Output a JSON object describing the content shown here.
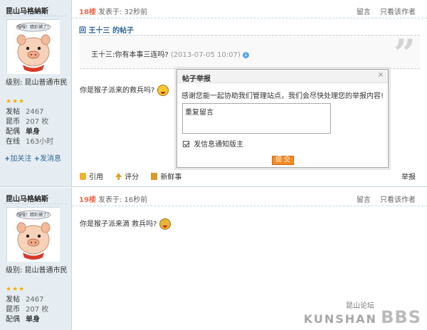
{
  "posts": [
    {
      "user": {
        "username": "昆山马格納斯",
        "avatar_text": "嘎嘎！精彩捕了！",
        "level": "级别: 昆山普通市民",
        "stars": "★★★",
        "stats": [
          {
            "label": "发帖",
            "value": "2467"
          },
          {
            "label": "昆币",
            "value": "207 枚"
          },
          {
            "label": "配偶",
            "value": "单身"
          },
          {
            "label": "在线",
            "value": "163小时"
          }
        ],
        "follow_label": "加关注",
        "message_label": "发消息"
      },
      "floor": "18楼",
      "posted": "发表于: 32秒前",
      "header_links": [
        "留言",
        "只看该作者"
      ],
      "quote": {
        "title": "回 王十三 的帖子",
        "text": "王十三:你有本事三连吗?",
        "time": "(2013-07-05 10:07)"
      },
      "message": "你是猴子派来的救兵吗?",
      "actions": [
        "引用",
        "评分",
        "新鲜事"
      ],
      "report_label": "举报"
    },
    {
      "user": {
        "username": "昆山马格納斯",
        "avatar_text": "嘎嘎！精彩捕了！",
        "level": "级别: 昆山普通市民",
        "stars": "★★★",
        "stats": [
          {
            "label": "发帖",
            "value": "2467"
          },
          {
            "label": "昆币",
            "value": "207 枚"
          },
          {
            "label": "配偶",
            "value": "单身"
          }
        ]
      },
      "floor": "19楼",
      "posted": "发表于: 16秒前",
      "header_links": [
        "留言",
        "只看该作者"
      ],
      "message": "你是猴子派来滴 救兵吗?"
    }
  ],
  "report_dialog": {
    "title": "帖子举报",
    "close": "×",
    "description": "感谢您能一起协助我们管理站点，我们会尽快处理您的举报内容!",
    "textarea_value": "重复留言",
    "checkbox_label": "发信息通知版主",
    "checkbox_checked": true,
    "submit_label": "提 交"
  },
  "watermark": {
    "latin": "KUNSHAN",
    "chinese": "昆山论坛",
    "bbs": "BBS"
  },
  "colors": {
    "floor": "#f26c4f",
    "sidebar_bg": "#e5edf2",
    "link": "#336699",
    "submit": "#f58b25"
  }
}
